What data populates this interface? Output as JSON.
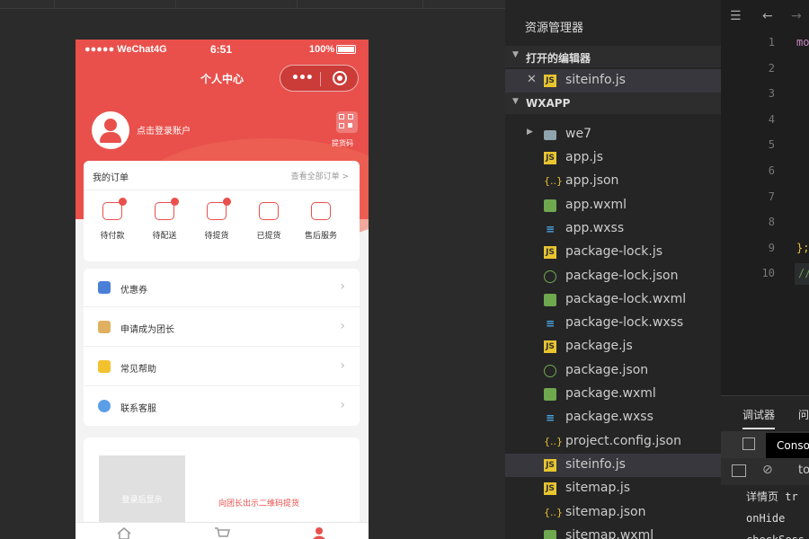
{
  "phone": {
    "status": {
      "carrier": "●●●●● WeChat4G",
      "time": "6:51",
      "battery": "100%"
    },
    "nav_title": "个人中心",
    "login_text": "点击登录账户",
    "qr_label": "提货码",
    "orders": {
      "title": "我的订单",
      "view_all": "查看全部订单 >",
      "items": [
        {
          "label": "待付款"
        },
        {
          "label": "待配送"
        },
        {
          "label": "待提货"
        },
        {
          "label": "已提货"
        },
        {
          "label": "售后服务"
        }
      ]
    },
    "menu": [
      {
        "label": "优惠券",
        "icon_color": "#4a7fd8"
      },
      {
        "label": "申请成为团长",
        "icon_color": "#e0b060"
      },
      {
        "label": "常见帮助",
        "icon_color": "#f2c12e"
      },
      {
        "label": "联系客服",
        "icon_color": "#5b9ee8"
      }
    ],
    "qr_section": {
      "placeholder": "登录后显示",
      "hint": "向团长出示二维码提货"
    }
  },
  "explorer": {
    "title": "资源管理器",
    "open_editors_label": "打开的编辑器",
    "open_file": "siteinfo.js",
    "project_label": "WXAPP",
    "folder": "we7",
    "files": [
      {
        "name": "app.js",
        "type": "js"
      },
      {
        "name": "app.json",
        "type": "json"
      },
      {
        "name": "app.wxml",
        "type": "wxml"
      },
      {
        "name": "app.wxss",
        "type": "wxss"
      },
      {
        "name": "package-lock.js",
        "type": "js"
      },
      {
        "name": "package-lock.json",
        "type": "pkg"
      },
      {
        "name": "package-lock.wxml",
        "type": "wxml"
      },
      {
        "name": "package-lock.wxss",
        "type": "wxss"
      },
      {
        "name": "package.js",
        "type": "js"
      },
      {
        "name": "package.json",
        "type": "pkg"
      },
      {
        "name": "package.wxml",
        "type": "wxml"
      },
      {
        "name": "package.wxss",
        "type": "wxss"
      },
      {
        "name": "project.config.json",
        "type": "json"
      },
      {
        "name": "siteinfo.js",
        "type": "js",
        "selected": true
      },
      {
        "name": "sitemap.js",
        "type": "js"
      },
      {
        "name": "sitemap.json",
        "type": "json"
      },
      {
        "name": "sitemap.wxml",
        "type": "wxml"
      }
    ]
  },
  "editor": {
    "line_numbers": [
      "1",
      "2",
      "3",
      "4",
      "5",
      "6",
      "7",
      "8",
      "9",
      "10"
    ],
    "code_fragments": {
      "line1": "mo",
      "line9": "};",
      "line10": "//"
    }
  },
  "debug": {
    "tabs": [
      "调试器",
      "问"
    ],
    "console_label": "Conso",
    "filter_text": "to",
    "lines": [
      "详情页 tr",
      "onHide",
      "checkSess"
    ]
  }
}
